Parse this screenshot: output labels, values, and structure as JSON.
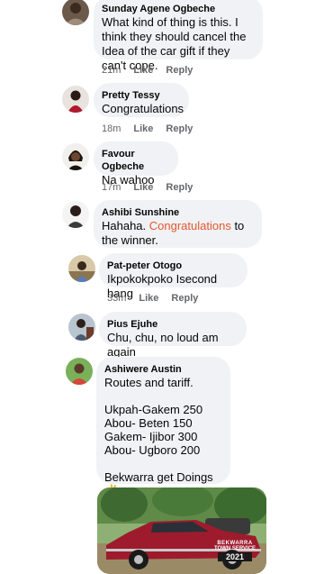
{
  "comments": [
    {
      "author": "Sunday Agene Ogbeche",
      "text": "What kind of thing is this. I think they should cancel the Idea of the car gift if they can't cope.",
      "time": "21m",
      "like": "Like",
      "reply": "Reply"
    },
    {
      "author": "Pretty Tessy",
      "text": "Congratulations",
      "time": "18m",
      "like": "Like",
      "reply": "Reply"
    },
    {
      "author": "Favour Ogbeche",
      "text": "Na wahoo",
      "time": "17m",
      "like": "Like",
      "reply": "Reply"
    },
    {
      "author": "Ashibi Sunshine",
      "text_before": "Hahaha. ",
      "text_highlight": "Congratulations",
      "text_after": " to the winner."
    },
    {
      "author": "Pat-peter Otogo",
      "text": "Ikpokokpoko Isecond hang",
      "time": "33m",
      "like": "Like",
      "reply": "Reply"
    },
    {
      "author": "Pius Ejuhe",
      "text": "Chu, chu, no loud am again"
    },
    {
      "author": "Ashiwere Austin",
      "text": "Routes and tariff.\n\nUkpah-Gakem   250\nAbou- Beten     150\nGakem- Ijibor   300\nAbou- Ugboro   200\n\nBekwarra get Doings ✌️"
    }
  ],
  "photo": {
    "watermark_line1": "BEKWARRA",
    "watermark_line2": "TOWN SERVICE",
    "watermark_line3": "2021"
  },
  "colors": {
    "bubble": "#f0f2f5",
    "meta": "#65676b",
    "highlight": "#e4572e"
  }
}
